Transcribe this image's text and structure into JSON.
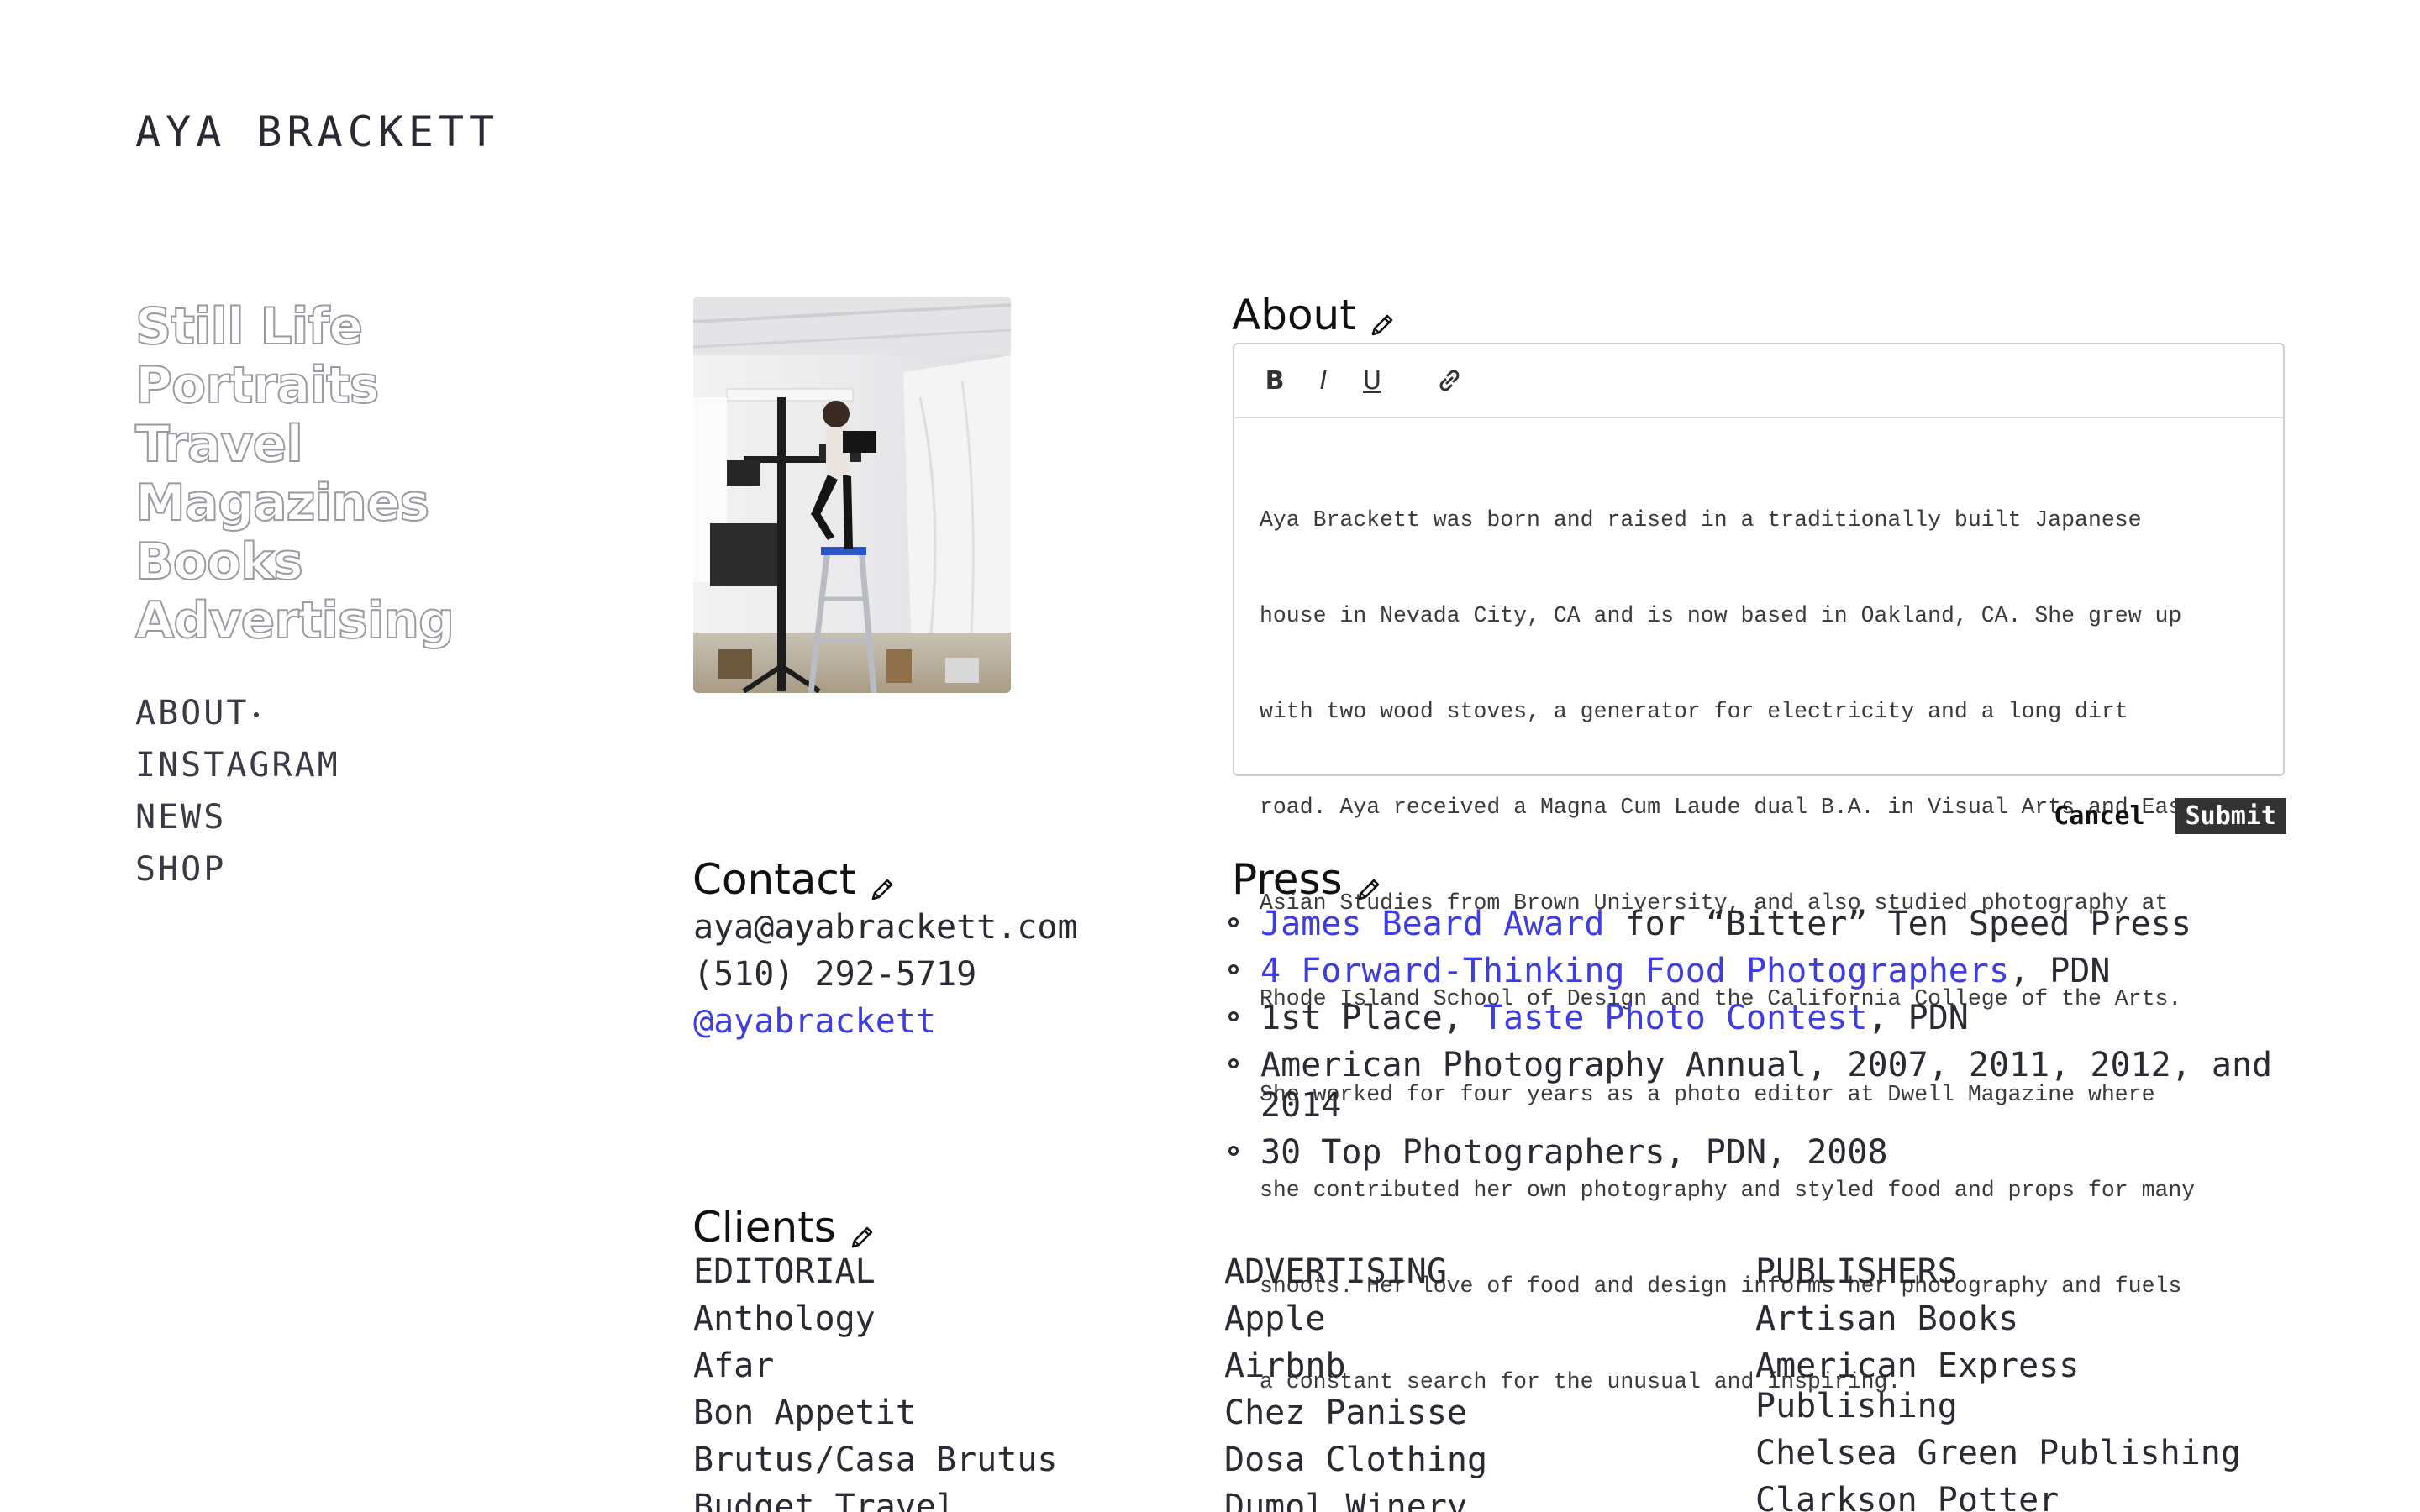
{
  "site": {
    "title": "AYA BRACKETT"
  },
  "portfolio_nav": [
    "Still Life",
    "Portraits",
    "Travel",
    "Magazines",
    "Books",
    "Advertising"
  ],
  "info_nav": [
    "ABOUT",
    "INSTAGRAM",
    "NEWS",
    "SHOP"
  ],
  "about": {
    "heading": "About",
    "toolbar": {
      "bold": "B",
      "italic": "I",
      "underline": "U",
      "link_icon": "link-icon"
    },
    "body_lines": [
      "Aya Brackett was born and raised in a traditionally built Japanese",
      "house in Nevada City, CA and is now based in Oakland, CA. She grew up",
      "with two wood stoves, a generator for electricity and a long dirt",
      "road. Aya received a Magna Cum Laude dual B.A. in Visual Arts and East",
      "Asian Studies from Brown University, and also studied photography at",
      "Rhode Island School of Design and the California College of the Arts.",
      "She worked for four years as a photo editor at Dwell Magazine where",
      "she contributed her own photography and styled food and props for many",
      "shoots. Her love of food and design informs her photography and fuels",
      "a constant search for the unusual and inspiring."
    ],
    "cancel_label": "Cancel",
    "submit_label": "Submit"
  },
  "contact": {
    "heading": "Contact",
    "email": "aya@ayabrackett.com",
    "phone": "(510) 292-5719",
    "instagram": "@ayabrackett"
  },
  "press": {
    "heading": "Press",
    "items": [
      {
        "link": "James Beard Award",
        "after": " for “Bitter” Ten Speed Press"
      },
      {
        "link": "4 Forward-Thinking Food Photographers",
        "after": ", PDN"
      },
      {
        "before": "1st Place, ",
        "link": "Taste Photo Contest",
        "after": ", PDN"
      },
      {
        "text": "American Photography Annual, 2007, 2011, 2012, and 2014"
      },
      {
        "text": "30 Top Photographers, PDN, 2008"
      }
    ]
  },
  "clients": {
    "heading": "Clients",
    "columns": [
      {
        "title": "EDITORIAL",
        "items": [
          "Anthology",
          "Afar",
          "Bon Appetit",
          "Brutus/Casa Brutus",
          "Budget Travel"
        ]
      },
      {
        "title": "ADVERTISING",
        "items": [
          "Apple",
          "Airbnb",
          "Chez Panisse",
          "Dosa Clothing",
          "Dumol Winery"
        ]
      },
      {
        "title": "PUBLISHERS",
        "items": [
          "Artisan Books",
          "American Express Publishing",
          "Chelsea Green Publishing",
          "Clarkson Potter"
        ]
      }
    ]
  },
  "colors": {
    "link": "#3d3de0",
    "text": "#2a2a33",
    "outline_nav": "#9a9aa2",
    "submit_bg": "#333333"
  }
}
